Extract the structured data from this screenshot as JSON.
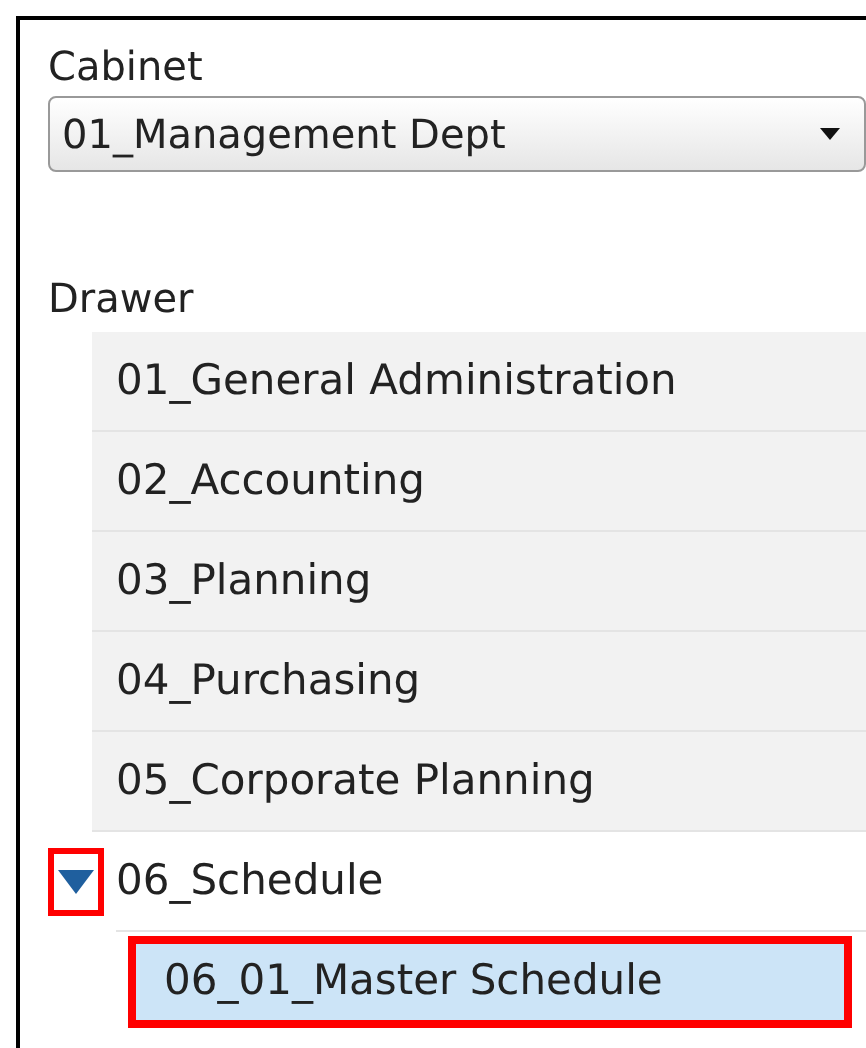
{
  "cabinet": {
    "label": "Cabinet",
    "value": "01_Management Dept"
  },
  "drawer": {
    "label": "Drawer",
    "items": [
      {
        "label": "01_General Administration"
      },
      {
        "label": "02_Accounting"
      },
      {
        "label": "03_Planning"
      },
      {
        "label": "04_Purchasing"
      },
      {
        "label": "05_Corporate Planning"
      },
      {
        "label": "06_Schedule",
        "expanded": true,
        "toggle_highlighted": true,
        "children": [
          {
            "label": "06_01_Master Schedule",
            "selected": true,
            "highlighted": true
          }
        ]
      }
    ]
  }
}
